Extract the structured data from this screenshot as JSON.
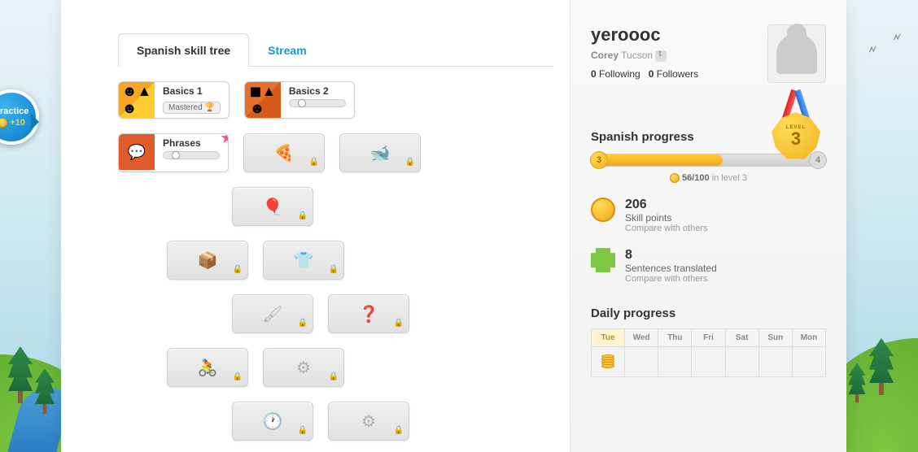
{
  "practice": {
    "label": "Practice",
    "points": "+10"
  },
  "tabs": {
    "tree": "Spanish skill tree",
    "stream": "Stream"
  },
  "skills": {
    "basics1": {
      "title": "Basics 1",
      "badge": "Mastered"
    },
    "basics2": {
      "title": "Basics 2"
    },
    "phrases": {
      "title": "Phrases"
    }
  },
  "profile": {
    "username": "yeroooc",
    "name": "Corey",
    "location": "Tucson",
    "following_count": "0",
    "following_label": "Following",
    "followers_count": "0",
    "followers_label": "Followers",
    "level_label": "LEVEL",
    "level": "3"
  },
  "progress": {
    "title": "Spanish progress",
    "start": "3",
    "end": "4",
    "current": "56",
    "total": "100",
    "caption_suffix": "in level 3"
  },
  "stats": {
    "points": {
      "value": "206",
      "label": "Skill points",
      "compare": "Compare with others"
    },
    "sentences": {
      "value": "8",
      "label": "Sentences translated",
      "compare": "Compare with others"
    }
  },
  "daily": {
    "title": "Daily progress",
    "days": [
      "Tue",
      "Wed",
      "Thu",
      "Fri",
      "Sat",
      "Sun",
      "Mon"
    ]
  }
}
